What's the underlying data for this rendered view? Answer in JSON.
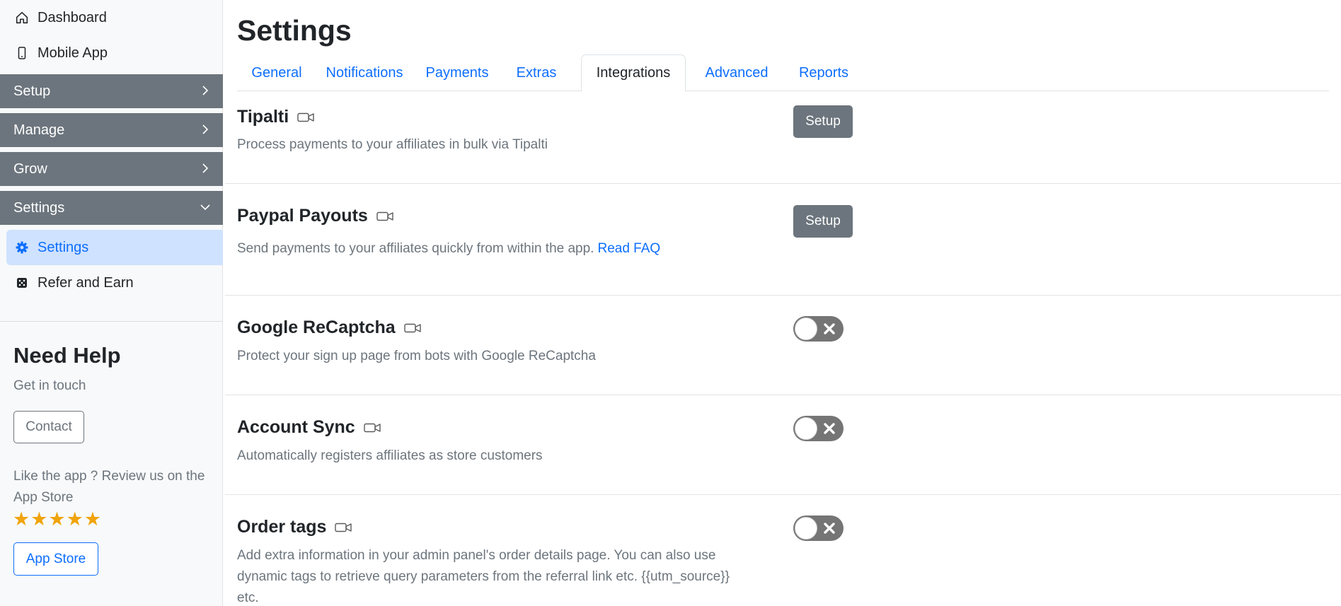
{
  "sidebar": {
    "top_items": [
      {
        "label": "Dashboard",
        "icon": "home-icon"
      },
      {
        "label": "Mobile App",
        "icon": "phone-icon"
      }
    ],
    "groups": [
      {
        "label": "Setup",
        "expanded": false
      },
      {
        "label": "Manage",
        "expanded": false
      },
      {
        "label": "Grow",
        "expanded": false
      },
      {
        "label": "Settings",
        "expanded": true
      }
    ],
    "sub_items": [
      {
        "label": "Settings",
        "icon": "gear-icon",
        "active": true
      },
      {
        "label": "Refer and Earn",
        "icon": "dice-icon",
        "active": false
      }
    ],
    "help": {
      "title": "Need Help",
      "subtitle": "Get in touch",
      "contact_label": "Contact",
      "review_text": "Like the app ? Review us on the App Store",
      "stars": "★★★★★",
      "app_store_label": "App Store"
    }
  },
  "main": {
    "title": "Settings",
    "tabs": [
      {
        "label": "General",
        "active": false
      },
      {
        "label": "Notifications",
        "active": false
      },
      {
        "label": "Payments",
        "active": false
      },
      {
        "label": "Extras",
        "active": false
      },
      {
        "label": "Integrations",
        "active": true
      },
      {
        "label": "Advanced",
        "active": false
      },
      {
        "label": "Reports",
        "active": false
      }
    ],
    "integrations": [
      {
        "title": "Tipalti",
        "description": "Process payments to your affiliates in bulk via Tipalti",
        "control": "button",
        "button_label": "Setup"
      },
      {
        "title": "Paypal Payouts",
        "description": "Send payments to your affiliates quickly from within the app.",
        "link": "Read FAQ",
        "control": "button",
        "button_label": "Setup"
      },
      {
        "title": "Google ReCaptcha",
        "description": "Protect your sign up page from bots with Google ReCaptcha",
        "control": "toggle",
        "enabled": false
      },
      {
        "title": "Account Sync",
        "description": "Automatically registers affiliates as store customers",
        "control": "toggle",
        "enabled": false
      },
      {
        "title": "Order tags",
        "description_lines": [
          "Add extra information in your admin panel's order details page. You can also use",
          "dynamic tags to retrieve query parameters from the referral link etc. {{utm_source}}",
          "etc."
        ],
        "control": "toggle",
        "enabled": false
      }
    ]
  },
  "colors": {
    "accent": "#0d6efd",
    "group_bg": "#6c757d",
    "active_bg": "#cfe2ff",
    "star": "#f0a30a",
    "toggle_off": "#757575"
  }
}
